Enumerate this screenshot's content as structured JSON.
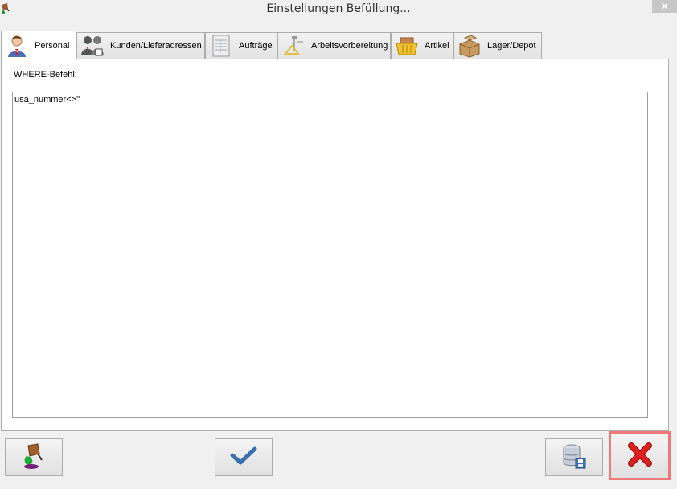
{
  "window": {
    "title": "Einstellungen Befüllung...",
    "close_glyph": "✕"
  },
  "tabs": [
    {
      "label": "Personal",
      "icon": "person-icon",
      "active": true
    },
    {
      "label": "Kunden/Lieferadressen",
      "icon": "people-icon",
      "active": false
    },
    {
      "label": "Aufträge",
      "icon": "orders-icon",
      "active": false
    },
    {
      "label": "Arbeitsvorbereitung",
      "icon": "tools-icon",
      "active": false
    },
    {
      "label": "Artikel",
      "icon": "basket-icon",
      "active": false
    },
    {
      "label": "Lager/Depot",
      "icon": "boxes-icon",
      "active": false
    }
  ],
  "panel": {
    "where_label": "WHERE-Befehl:",
    "where_value": "usa_nummer<>''"
  },
  "buttons": [
    {
      "name": "fill-button",
      "icon": "paint-bucket-icon"
    },
    {
      "name": "ok-button",
      "icon": "checkmark-icon"
    },
    {
      "name": "save-db-button",
      "icon": "database-save-icon"
    },
    {
      "name": "cancel-button",
      "icon": "red-x-icon"
    }
  ],
  "colors": {
    "focus_border": "#f0797a",
    "cancel_red": "#e0201f",
    "check_blue": "#3a6fb0"
  }
}
